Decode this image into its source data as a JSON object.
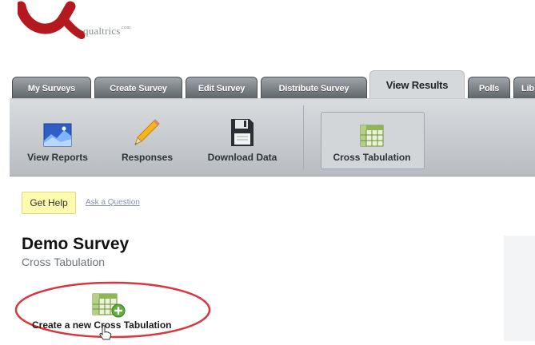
{
  "header": {
    "brand_name": "qualtrics",
    "brand_suffix": ".com"
  },
  "tabs": [
    {
      "label": "My Surveys",
      "active": false
    },
    {
      "label": "Create Survey",
      "active": false
    },
    {
      "label": "Edit Survey",
      "active": false
    },
    {
      "label": "Distribute Survey",
      "active": false
    },
    {
      "label": "View Results",
      "active": true
    },
    {
      "label": "Polls",
      "active": false
    },
    {
      "label": "Lib",
      "active": false
    }
  ],
  "toolbar": {
    "view_reports": {
      "label": "View Reports",
      "icon": "chart-image-icon"
    },
    "responses": {
      "label": "Responses",
      "icon": "pencil-icon"
    },
    "download_data": {
      "label": "Download Data",
      "icon": "floppy-disk-icon"
    },
    "cross_tabulation": {
      "label": "Cross Tabulation",
      "icon": "table-icon",
      "selected": true
    }
  },
  "help": {
    "get_help": "Get Help",
    "ask_question": "Ask a Question"
  },
  "survey": {
    "title": "Demo Survey",
    "subtitle": "Cross Tabulation"
  },
  "create": {
    "label": "Create a new Cross Tabulation",
    "icon": "table-add-icon"
  },
  "colors": {
    "brand_red": "#b3191f",
    "tab_dark": "#5d6468",
    "help_yellow": "#fdfbb0",
    "annotation_red": "#d9363e"
  }
}
